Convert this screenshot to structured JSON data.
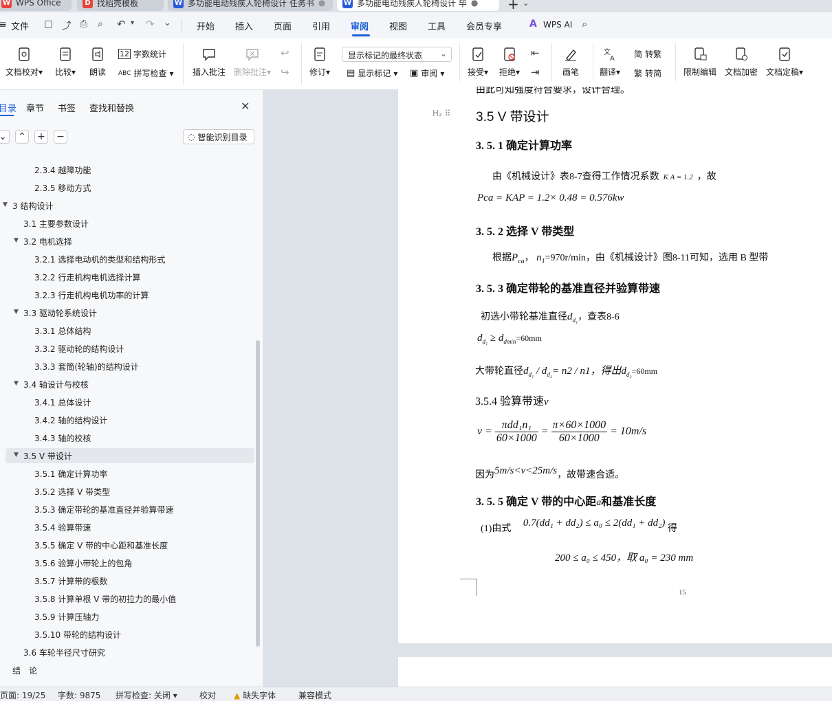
{
  "tabs": {
    "t1": "WPS Office",
    "t2": "找稻壳模板",
    "t3": "多功能电动残疾人轮椅设计 任务书",
    "t4": "多功能电动残疾人轮椅设计 毕"
  },
  "menu": {
    "file": "文件",
    "items": [
      "开始",
      "插入",
      "页面",
      "引用",
      "审阅",
      "视图",
      "工具",
      "会员专享"
    ],
    "wps_ai": "WPS AI"
  },
  "ribbon": {
    "doc_check": "文档校对",
    "compare": "比较",
    "read": "朗读",
    "word_count": "字数统计",
    "spell_check": "拼写检查",
    "insert_comment": "插入批注",
    "delete_comment": "删除批注",
    "revise": "修订",
    "markup_select": "显示标记的最终状态",
    "show_markup": "显示标记",
    "review": "审阅",
    "accept": "接受",
    "reject": "拒绝",
    "pen": "画笔",
    "translate": "翻译",
    "to_trad": "转繁",
    "to_simp": "转简",
    "restrict_edit": "限制编辑",
    "encrypt": "文档加密",
    "finalize": "文档定稿"
  },
  "sidebar": {
    "tabs": [
      "目录",
      "章节",
      "书签",
      "查找和替换"
    ],
    "smart_toc": "智能识别目录",
    "items": [
      {
        "label": "2.3.4 越障功能",
        "level": 3
      },
      {
        "label": "2.3.5 移动方式",
        "level": 3
      },
      {
        "label": "3 结构设计",
        "level": 1
      },
      {
        "label": "3.1 主要参数设计",
        "level": 2
      },
      {
        "label": "3.2 电机选择",
        "level": 2
      },
      {
        "label": "3.2.1 选择电动机的类型和结构形式",
        "level": 3
      },
      {
        "label": "3.2.2 行走机构电机选择计算",
        "level": 3
      },
      {
        "label": "3.2.3 行走机构电机功率的计算",
        "level": 3
      },
      {
        "label": "3.3 驱动轮系统设计",
        "level": 2
      },
      {
        "label": "3.3.1 总体结构",
        "level": 3
      },
      {
        "label": "3.3.2 驱动轮的结构设计",
        "level": 3
      },
      {
        "label": "3.3.3 套筒(轮轴)的结构设计",
        "level": 3
      },
      {
        "label": "3.4 轴设计与校核",
        "level": 2
      },
      {
        "label": "3.4.1 总体设计",
        "level": 3
      },
      {
        "label": "3.4.2 轴的结构设计",
        "level": 3
      },
      {
        "label": "3.4.3 轴的校核",
        "level": 3
      },
      {
        "label": "3.5 V 带设计",
        "level": 2
      },
      {
        "label": "3.5.1 确定计算功率",
        "level": 3
      },
      {
        "label": "3.5.2 选择 V 带类型",
        "level": 3
      },
      {
        "label": "3.5.3 确定带轮的基准直径并验算带速",
        "level": 3
      },
      {
        "label": "3.5.4 验算带速",
        "level": 3
      },
      {
        "label": "3.5.5 确定 V 带的中心距和基准长度",
        "level": 3
      },
      {
        "label": "3.5.6 验算小带轮上的包角",
        "level": 3
      },
      {
        "label": "3.5.7 计算带的根数",
        "level": 3
      },
      {
        "label": "3.5.8 计算单根 V 带的初拉力的最小值",
        "level": 3
      },
      {
        "label": "3.5.9 计算压轴力",
        "level": 3
      },
      {
        "label": "3.5.10 带轮的结构设计",
        "level": 3
      },
      {
        "label": "3.6 车轮半径尺寸研究",
        "level": 2
      },
      {
        "label": "结　论",
        "level": 1
      }
    ]
  },
  "doc": {
    "top_partial": "由此可知强度符合要求，设计合理。",
    "heading_badge": "H₂",
    "h_35": "3.5 V 带设计",
    "h_351": "3. 5. 1 确定计算功率",
    "p1": "由《机械设计》表8-7查得工作情况系数",
    "p1_ka": "K A = 1.2",
    "p1_end": "，故",
    "eq1": "Pca = KAP = 1.2× 0.48 = 0.576kw",
    "h_352": "3. 5. 2 选择 V 带类型",
    "p2": "根据",
    "p2_mid": "=970r/min，由《机械设计》图8-11可知，选用 B 型带",
    "h_353": "3. 5. 3 确定带轮的基准直径并验算带速",
    "p3": "初选小带轮基准直径",
    "p3_end": "，查表8-6",
    "eq2": "=60mm",
    "p4": "大带轮直径",
    "p4_mid": "= n2 / n1，得出",
    "p4_end": "=60mm",
    "h_354": "3.5.4 验算带速",
    "eq3_num1": "πdd₁n₁",
    "eq3_den1": "60×1000",
    "eq3_num2": "π×60×1000",
    "eq3_den2": "60×1000",
    "eq3_res": "= 10m/s",
    "p5": "因为",
    "p5_mid": "5m/s<v<25m/s",
    "p5_end": "，故带速合适。",
    "h_355": "3. 5. 5 确定 V 带的中心距",
    "h_355_end": "和基准长度",
    "p6": "(1)由式",
    "eq4": "0.7(dd₁ + dd₂) ≤ a₀ ≤ 2(dd₁ + dd₂)",
    "p6_end": "得",
    "eq5": "200 ≤ a₀ ≤ 450，取 a₀ = 230 mm",
    "page_no": "15"
  },
  "status": {
    "page": "页面: 19/25",
    "words": "字数: 9875",
    "spell": "拼写检查: 关闭",
    "proof": "校对",
    "missing_font": "缺失字体",
    "compat": "兼容模式"
  },
  "colors": {
    "accent": "#1a5fd6",
    "wps_red": "#e8433a",
    "word_blue": "#2b5bd7"
  }
}
